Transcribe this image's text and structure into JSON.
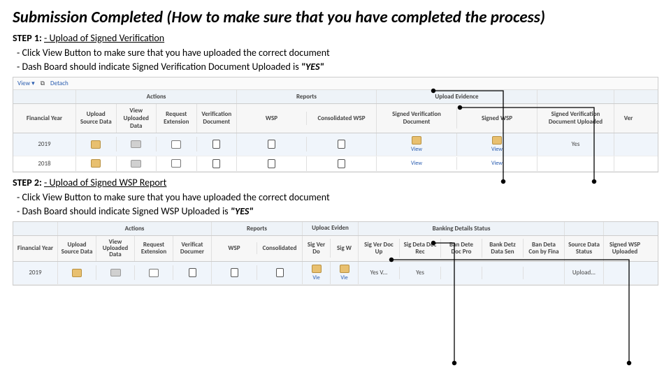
{
  "title": "Submission Completed (How to make sure that you have completed the process)",
  "step1": {
    "label": "STEP 1:",
    "heading": "- Upload of Signed Verification",
    "bullet1": "Click View Button to make sure that you have uploaded the correct document",
    "bullet2_pre": "Dash Board should indicate Signed Verification Document Uploaded is ",
    "bullet2_val": "\"YES\""
  },
  "step2": {
    "label": "STEP 2:",
    "heading": "-  Upload of Signed WSP Report",
    "bullet1": "Click View Button to make sure that you have uploaded the correct document",
    "bullet2_pre": "Dash Board should indicate Signed WSP Uploaded is ",
    "bullet2_val": "\"YES\""
  },
  "dash1": {
    "toolbar": {
      "view": "View ▾",
      "detach_icon": "⧉",
      "detach": "Detach"
    },
    "groups": {
      "actions": "Actions",
      "reports": "Reports",
      "upload_evidence": "Upload Evidence"
    },
    "headers": {
      "fy": "Financial Year",
      "usd": "Upload Source Data",
      "vud": "View Uploaded Data",
      "rex": "Request Extension",
      "vdoc": "Verification Document",
      "wsp": "WSP",
      "cwsp": "Consolidated WSP",
      "svd": "Signed Verification Document",
      "swsp": "Signed WSP",
      "svdu": "Signed Verification Document Uploaded",
      "ver": "Ver"
    },
    "rows": [
      {
        "fy": "2019",
        "view": "View",
        "svdu": "Yes"
      },
      {
        "fy": "2018",
        "view": "View",
        "svdu": ""
      }
    ]
  },
  "dash2": {
    "groups": {
      "actions": "Actions",
      "reports": "Reports",
      "upev": "Uploac Eviden",
      "bank": "Banking Details Status"
    },
    "headers": {
      "fy": "Financial Year",
      "usd": "Upload Source Data",
      "vud": "View Uploaded Data",
      "rex": "Request Extension",
      "vdoc": "Verificat Documer",
      "wsp": "WSP",
      "cons": "Consolidated",
      "sigv": "Sig Ver Do",
      "sigw": "Sig W",
      "ver1": "Sig Ver Doc Up",
      "ver2": "Sig Deta Doc Rec",
      "ban1": "Ban Dete Doc Pro",
      "ban2": "Bank Detz Data Sen",
      "ban3": "Ban Deta Con by Fina",
      "src": "Source Data Status",
      "swspu": "Signed WSP Uploaded"
    },
    "rows": [
      {
        "fy": "2019",
        "v1": "Vie",
        "v2": "Vie",
        "a": "Yes V...",
        "b": "Yes",
        "c": "",
        "d": "",
        "e": "",
        "src": "Upload...",
        "swspu": ""
      }
    ]
  }
}
